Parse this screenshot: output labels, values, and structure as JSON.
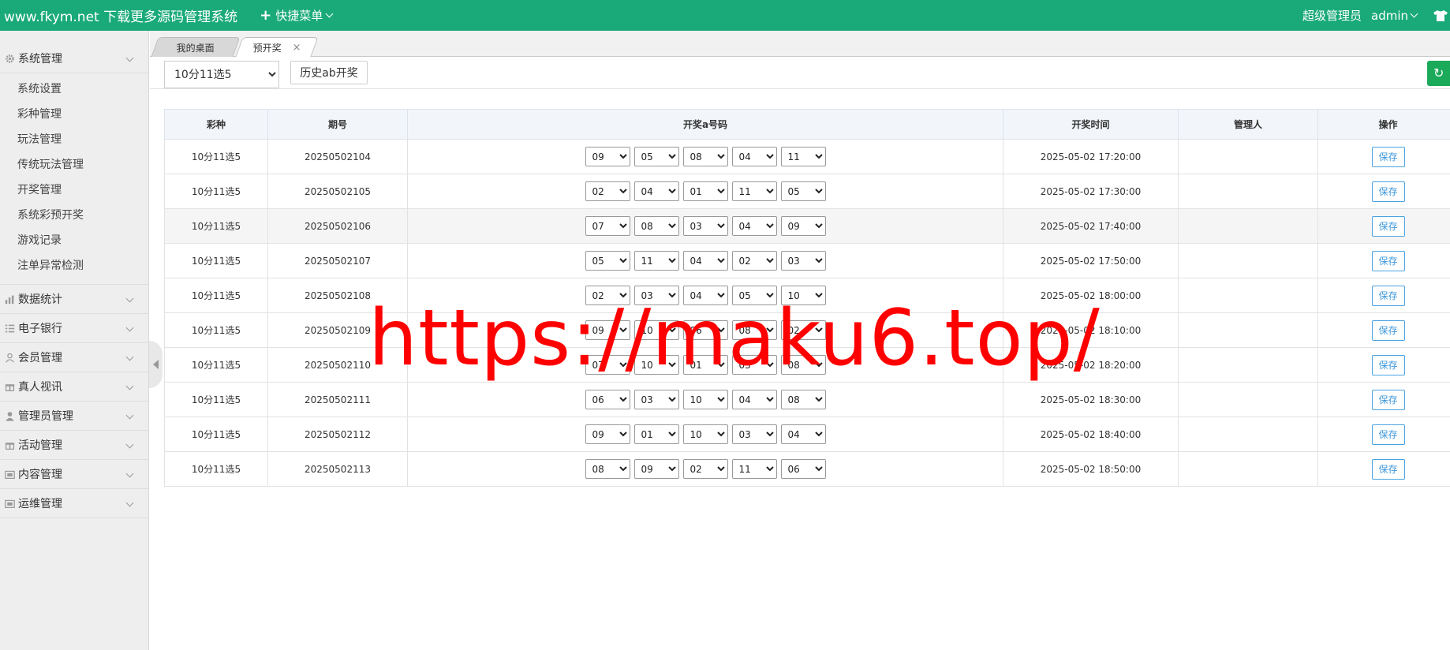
{
  "header": {
    "brand": "www.fkym.net 下载更多源码管理系统",
    "quick_menu": "快捷菜单",
    "role": "超级管理员",
    "user": "admin"
  },
  "sidebar": {
    "groups": [
      {
        "label": "系统管理",
        "icon": "gear-icon",
        "expanded": true,
        "items": [
          "系统设置",
          "彩种管理",
          "玩法管理",
          "传统玩法管理",
          "开奖管理",
          "系统彩预开奖",
          "游戏记录",
          "注单异常检测"
        ]
      },
      {
        "label": "数据统计",
        "icon": "bar-chart-icon"
      },
      {
        "label": "电子银行",
        "icon": "list-icon"
      },
      {
        "label": "会员管理",
        "icon": "user-icon"
      },
      {
        "label": "真人视讯",
        "icon": "gift-icon"
      },
      {
        "label": "管理员管理",
        "icon": "person-icon"
      },
      {
        "label": "活动管理",
        "icon": "gift-icon"
      },
      {
        "label": "内容管理",
        "icon": "gallery-icon"
      },
      {
        "label": "运维管理",
        "icon": "gallery-icon"
      }
    ]
  },
  "tabs": {
    "desk": "我的桌面",
    "pre": "预开奖",
    "close": "×"
  },
  "toolbar": {
    "lottery_selected": "10分11选5",
    "history_btn": "历史ab开奖",
    "refresh_icon": "refresh-icon"
  },
  "table": {
    "headers": [
      "彩种",
      "期号",
      "开奖a号码",
      "开奖时间",
      "管理人",
      "操作"
    ],
    "save_label": "保存",
    "rows": [
      {
        "lottery": "10分11选5",
        "issue": "20250502104",
        "nums": [
          "09",
          "05",
          "08",
          "04",
          "11"
        ],
        "time": "2025-05-02 17:20:00",
        "manager": ""
      },
      {
        "lottery": "10分11选5",
        "issue": "20250502105",
        "nums": [
          "02",
          "04",
          "01",
          "11",
          "05"
        ],
        "time": "2025-05-02 17:30:00",
        "manager": ""
      },
      {
        "lottery": "10分11选5",
        "issue": "20250502106",
        "nums": [
          "07",
          "08",
          "03",
          "04",
          "09"
        ],
        "time": "2025-05-02 17:40:00",
        "manager": ""
      },
      {
        "lottery": "10分11选5",
        "issue": "20250502107",
        "nums": [
          "05",
          "11",
          "04",
          "02",
          "03"
        ],
        "time": "2025-05-02 17:50:00",
        "manager": ""
      },
      {
        "lottery": "10分11选5",
        "issue": "20250502108",
        "nums": [
          "02",
          "03",
          "04",
          "05",
          "10"
        ],
        "time": "2025-05-02 18:00:00",
        "manager": ""
      },
      {
        "lottery": "10分11选5",
        "issue": "20250502109",
        "nums": [
          "09",
          "10",
          "06",
          "08",
          "02"
        ],
        "time": "2025-05-02 18:10:00",
        "manager": ""
      },
      {
        "lottery": "10分11选5",
        "issue": "20250502110",
        "nums": [
          "07",
          "10",
          "01",
          "03",
          "08"
        ],
        "time": "2025-05-02 18:20:00",
        "manager": ""
      },
      {
        "lottery": "10分11选5",
        "issue": "20250502111",
        "nums": [
          "06",
          "03",
          "10",
          "04",
          "08"
        ],
        "time": "2025-05-02 18:30:00",
        "manager": ""
      },
      {
        "lottery": "10分11选5",
        "issue": "20250502112",
        "nums": [
          "09",
          "01",
          "10",
          "03",
          "04"
        ],
        "time": "2025-05-02 18:40:00",
        "manager": ""
      },
      {
        "lottery": "10分11选5",
        "issue": "20250502113",
        "nums": [
          "08",
          "09",
          "02",
          "11",
          "06"
        ],
        "time": "2025-05-02 18:50:00",
        "manager": ""
      }
    ]
  },
  "watermark": "https://maku6.top/",
  "colors": {
    "header_bg": "#1aaa7a",
    "accent_blue": "#3d97db",
    "watermark": "#ff0000"
  }
}
